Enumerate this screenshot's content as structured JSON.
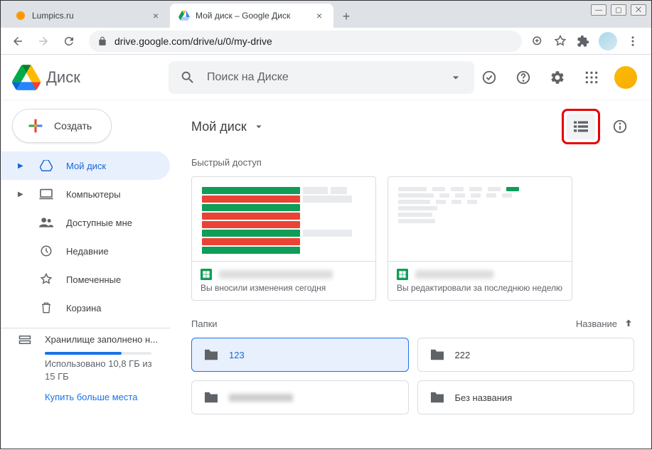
{
  "browser": {
    "tabs": [
      {
        "title": "Lumpics.ru",
        "favicon_color": "#ff9800"
      },
      {
        "title": "Мой диск – Google Диск",
        "favicon": "drive"
      }
    ],
    "url": "drive.google.com/drive/u/0/my-drive"
  },
  "drive": {
    "brand": "Диск",
    "search_placeholder": "Поиск на Диске",
    "create_label": "Создать",
    "sidebar": {
      "items": [
        {
          "label": "Мой диск",
          "icon": "drive",
          "active": true,
          "expandable": true
        },
        {
          "label": "Компьютеры",
          "icon": "computers",
          "expandable": true
        },
        {
          "label": "Доступные мне",
          "icon": "shared"
        },
        {
          "label": "Недавние",
          "icon": "recent"
        },
        {
          "label": "Помеченные",
          "icon": "starred"
        },
        {
          "label": "Корзина",
          "icon": "trash"
        }
      ],
      "storage": {
        "title": "Хранилище заполнено н...",
        "usage": "Использовано 10,8 ГБ из 15 ГБ",
        "buy": "Купить больше места"
      }
    },
    "main": {
      "breadcrumb": "Мой диск",
      "quick_access_title": "Быстрый доступ",
      "quick_access": [
        {
          "subtitle": "Вы вносили изменения сегодня"
        },
        {
          "subtitle": "Вы редактировали за последнюю неделю"
        }
      ],
      "folders_title": "Папки",
      "sort_label": "Название",
      "folders": [
        {
          "name": "123",
          "selected": true
        },
        {
          "name": "222"
        },
        {
          "name": "",
          "blurred": true
        },
        {
          "name": "Без названия"
        }
      ]
    }
  }
}
